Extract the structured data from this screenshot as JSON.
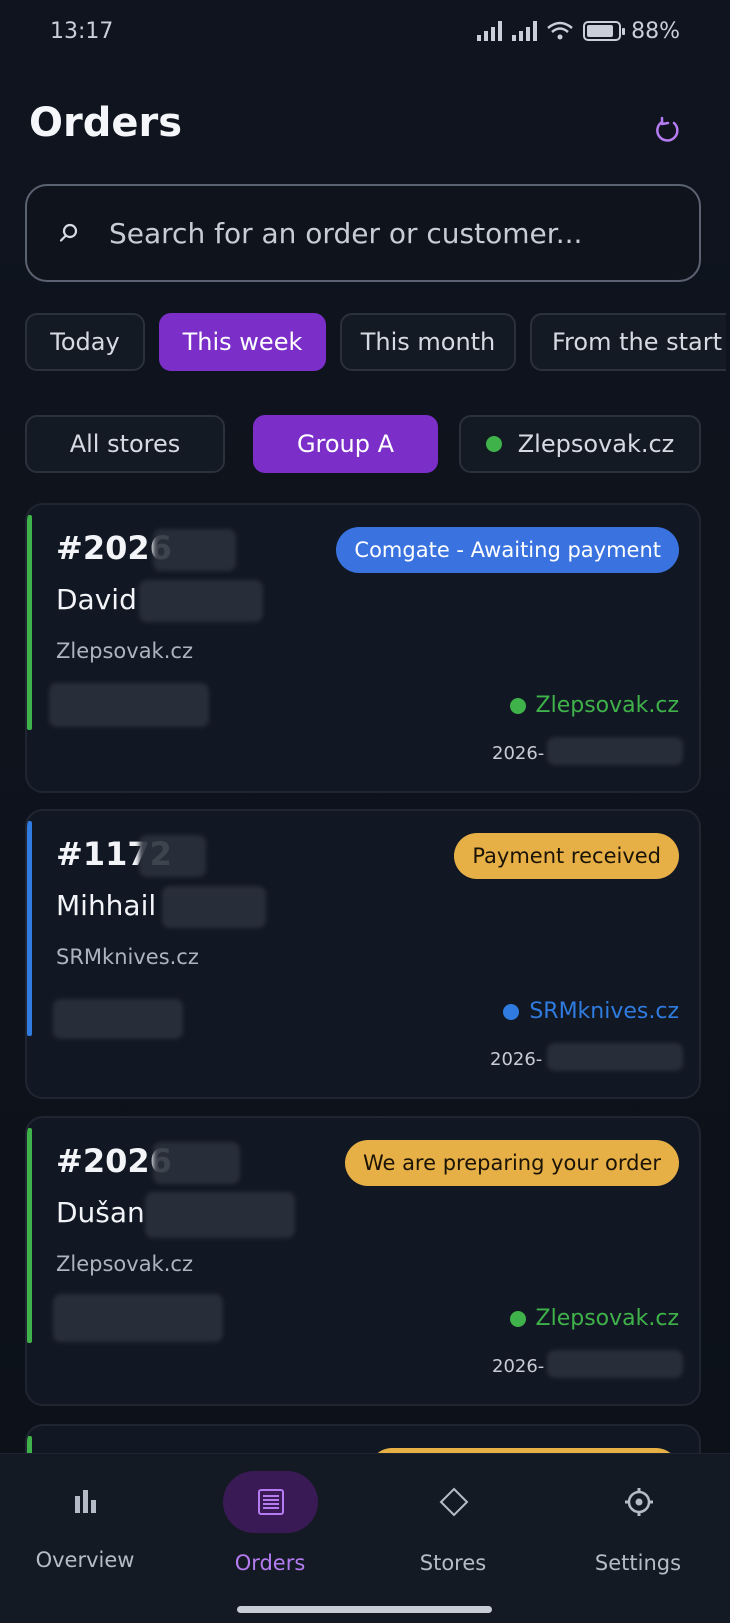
{
  "status_bar": {
    "time": "13:17",
    "battery": "88%"
  },
  "header": {
    "title": "Orders"
  },
  "search": {
    "placeholder": "Search for an order or customer..."
  },
  "period_filters": [
    {
      "label": "Today",
      "active": false
    },
    {
      "label": "This week",
      "active": true
    },
    {
      "label": "This month",
      "active": false
    },
    {
      "label": "From the start",
      "active": false
    }
  ],
  "store_filters": [
    {
      "label": "All stores",
      "active": false
    },
    {
      "label": "Group A",
      "active": true
    },
    {
      "label": "Zlepsovak.cz",
      "active": false
    }
  ],
  "orders": [
    {
      "number": "#2026",
      "customer": "David",
      "store": "Zlepsovak.cz",
      "status": "Comgate - Awaiting payment",
      "status_color": "#3a73e0",
      "store_color": "#3fb24a",
      "date_prefix": "2026-"
    },
    {
      "number": "#1172",
      "customer": "Mihhail",
      "store": "SRMknives.cz",
      "status": "Payment received",
      "status_color": "#e7b046",
      "store_color": "#2f7be0",
      "date_prefix": "2026-"
    },
    {
      "number": "#2026",
      "customer": "Dušan",
      "store": "Zlepsovak.cz",
      "status": "We are preparing your order",
      "status_color": "#e7b046",
      "store_color": "#3fb24a",
      "date_prefix": "2026-"
    }
  ],
  "bottom_nav": [
    {
      "label": "Overview",
      "icon": "bar-chart-icon",
      "active": false
    },
    {
      "label": "Orders",
      "icon": "list-icon",
      "active": true
    },
    {
      "label": "Stores",
      "icon": "diamond-icon",
      "active": false
    },
    {
      "label": "Settings",
      "icon": "gear-icon",
      "active": false
    }
  ],
  "colors": {
    "accent": "#7b2fc8",
    "accent_light": "#b57cf2"
  }
}
